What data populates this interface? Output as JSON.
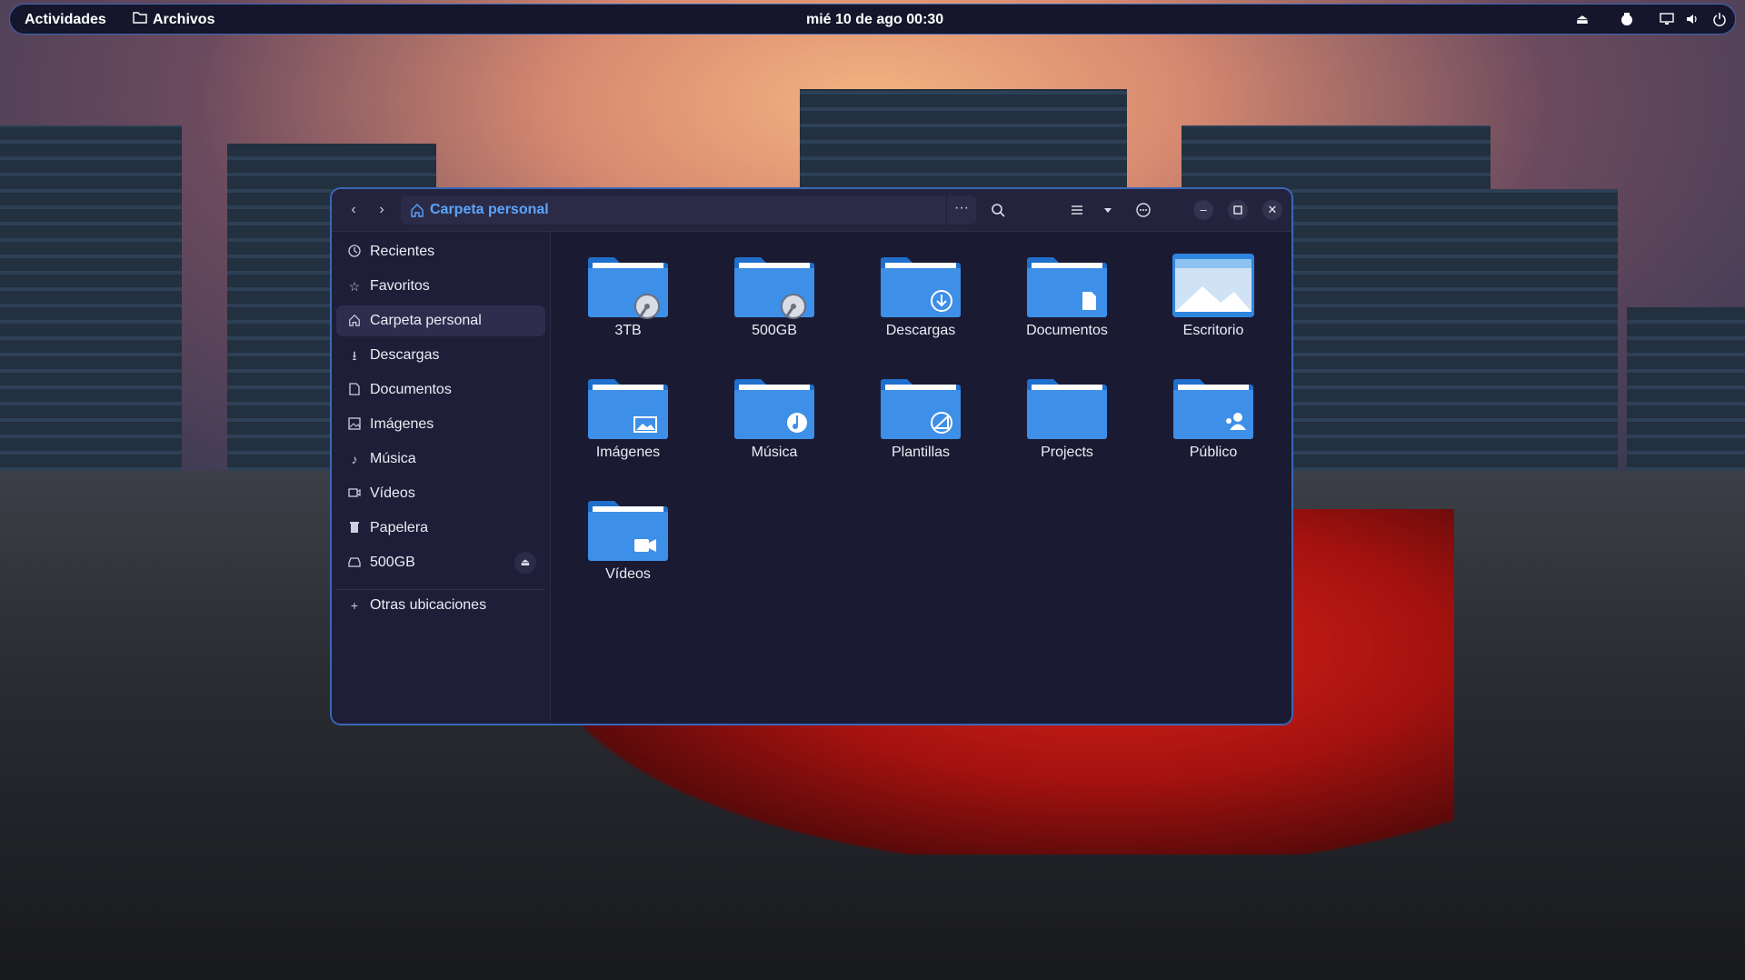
{
  "topbar": {
    "activities": "Actividades",
    "app_name": "Archivos",
    "clock": "mié 10 de ago  00:30"
  },
  "window": {
    "location": "Carpeta personal",
    "more_label": "···"
  },
  "sidebar": {
    "items": [
      {
        "label": "Recientes",
        "icon": "clock-icon"
      },
      {
        "label": "Favoritos",
        "icon": "star-icon"
      },
      {
        "label": "Carpeta personal",
        "icon": "home-icon",
        "active": true
      },
      {
        "label": "Descargas",
        "icon": "download-icon"
      },
      {
        "label": "Documentos",
        "icon": "document-icon"
      },
      {
        "label": "Imágenes",
        "icon": "image-icon"
      },
      {
        "label": "Música",
        "icon": "music-icon"
      },
      {
        "label": "Vídeos",
        "icon": "video-icon"
      },
      {
        "label": "Papelera",
        "icon": "trash-icon"
      },
      {
        "label": "500GB",
        "icon": "drive-icon"
      }
    ],
    "other_locations": "Otras ubicaciones"
  },
  "folders": [
    {
      "name": "3TB",
      "emblem": "drive"
    },
    {
      "name": "500GB",
      "emblem": "drive"
    },
    {
      "name": "Descargas",
      "emblem": "download"
    },
    {
      "name": "Documentos",
      "emblem": "document"
    },
    {
      "name": "Escritorio",
      "emblem": "desktop"
    },
    {
      "name": "Imágenes",
      "emblem": "image"
    },
    {
      "name": "Música",
      "emblem": "music"
    },
    {
      "name": "Plantillas",
      "emblem": "template"
    },
    {
      "name": "Projects",
      "emblem": "none"
    },
    {
      "name": "Público",
      "emblem": "people"
    },
    {
      "name": "Vídeos",
      "emblem": "video"
    }
  ],
  "colors": {
    "accent": "#3a67b8",
    "path_text": "#5aa4ff",
    "folder": "#3d8fe8",
    "window_bg": "#1b1a33"
  }
}
